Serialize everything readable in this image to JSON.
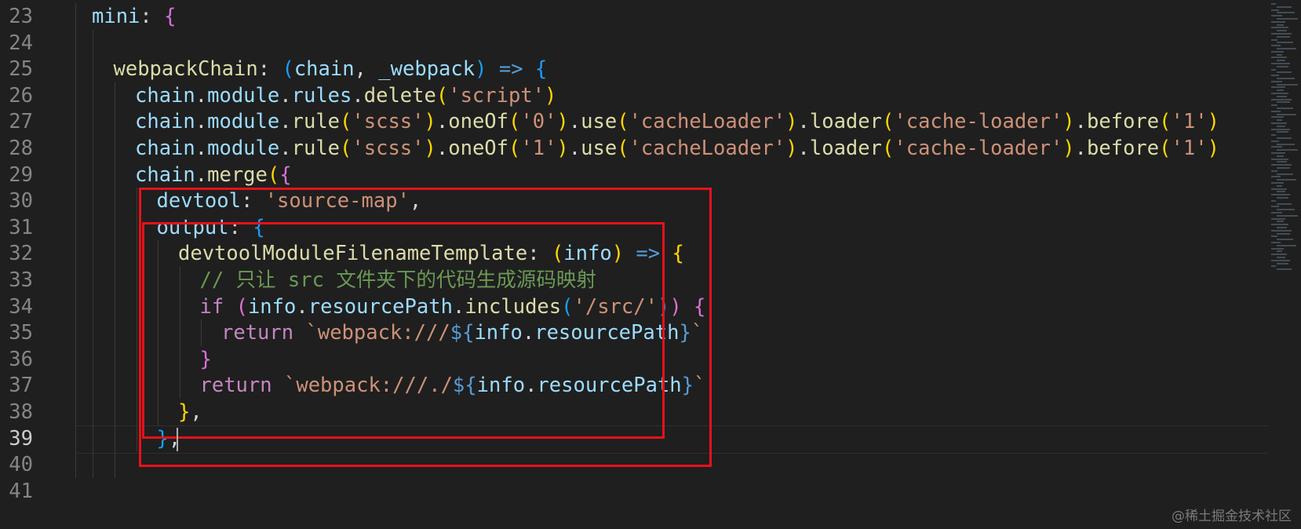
{
  "editor": {
    "colors": {
      "background": "#1f1f1f",
      "line_number": "#858585",
      "line_number_active": "#cccccc",
      "highlight_box": "#e8111b"
    },
    "token_colors": {
      "prop": "#9cdcfe",
      "punct": "#d4d4d4",
      "str": "#ce9178",
      "fn": "#dcdcaa",
      "kw": "#c586c0",
      "op": "#569cd6",
      "b1": "#ffd700",
      "b2": "#da70d6",
      "b3": "#179fff",
      "cmt": "#6a9955"
    },
    "active_line": 39,
    "lines": [
      {
        "n": "23",
        "indent": 1,
        "tokens": [
          [
            "mini",
            "prop"
          ],
          [
            ": ",
            "punct"
          ],
          [
            "{",
            "b2"
          ]
        ]
      },
      {
        "n": "24",
        "indent": 0,
        "tokens": []
      },
      {
        "n": "25",
        "indent": 2,
        "tokens": [
          [
            "webpackChain",
            "fn"
          ],
          [
            ": ",
            "punct"
          ],
          [
            "(",
            "b3"
          ],
          [
            "chain",
            "prop"
          ],
          [
            ", ",
            "punct"
          ],
          [
            "_webpack",
            "prop"
          ],
          [
            ")",
            "b3"
          ],
          [
            " => ",
            "op"
          ],
          [
            "{",
            "b3"
          ]
        ]
      },
      {
        "n": "26",
        "indent": 3,
        "tokens": [
          [
            "chain",
            "prop"
          ],
          [
            ".",
            "punct"
          ],
          [
            "module",
            "prop"
          ],
          [
            ".",
            "punct"
          ],
          [
            "rules",
            "prop"
          ],
          [
            ".",
            "punct"
          ],
          [
            "delete",
            "fn"
          ],
          [
            "(",
            "b1"
          ],
          [
            "'script'",
            "str"
          ],
          [
            ")",
            "b1"
          ]
        ]
      },
      {
        "n": "27",
        "indent": 3,
        "tokens": [
          [
            "chain",
            "prop"
          ],
          [
            ".",
            "punct"
          ],
          [
            "module",
            "prop"
          ],
          [
            ".",
            "punct"
          ],
          [
            "rule",
            "fn"
          ],
          [
            "(",
            "b1"
          ],
          [
            "'scss'",
            "str"
          ],
          [
            ")",
            "b1"
          ],
          [
            ".",
            "punct"
          ],
          [
            "oneOf",
            "fn"
          ],
          [
            "(",
            "b1"
          ],
          [
            "'0'",
            "str"
          ],
          [
            ")",
            "b1"
          ],
          [
            ".",
            "punct"
          ],
          [
            "use",
            "fn"
          ],
          [
            "(",
            "b1"
          ],
          [
            "'cacheLoader'",
            "str"
          ],
          [
            ")",
            "b1"
          ],
          [
            ".",
            "punct"
          ],
          [
            "loader",
            "fn"
          ],
          [
            "(",
            "b1"
          ],
          [
            "'cache-loader'",
            "str"
          ],
          [
            ")",
            "b1"
          ],
          [
            ".",
            "punct"
          ],
          [
            "before",
            "fn"
          ],
          [
            "(",
            "b1"
          ],
          [
            "'1'",
            "str"
          ],
          [
            ")",
            "b1"
          ]
        ]
      },
      {
        "n": "28",
        "indent": 3,
        "tokens": [
          [
            "chain",
            "prop"
          ],
          [
            ".",
            "punct"
          ],
          [
            "module",
            "prop"
          ],
          [
            ".",
            "punct"
          ],
          [
            "rule",
            "fn"
          ],
          [
            "(",
            "b1"
          ],
          [
            "'scss'",
            "str"
          ],
          [
            ")",
            "b1"
          ],
          [
            ".",
            "punct"
          ],
          [
            "oneOf",
            "fn"
          ],
          [
            "(",
            "b1"
          ],
          [
            "'1'",
            "str"
          ],
          [
            ")",
            "b1"
          ],
          [
            ".",
            "punct"
          ],
          [
            "use",
            "fn"
          ],
          [
            "(",
            "b1"
          ],
          [
            "'cacheLoader'",
            "str"
          ],
          [
            ")",
            "b1"
          ],
          [
            ".",
            "punct"
          ],
          [
            "loader",
            "fn"
          ],
          [
            "(",
            "b1"
          ],
          [
            "'cache-loader'",
            "str"
          ],
          [
            ")",
            "b1"
          ],
          [
            ".",
            "punct"
          ],
          [
            "before",
            "fn"
          ],
          [
            "(",
            "b1"
          ],
          [
            "'1'",
            "str"
          ],
          [
            ")",
            "b1"
          ]
        ]
      },
      {
        "n": "29",
        "indent": 3,
        "tokens": [
          [
            "chain",
            "prop"
          ],
          [
            ".",
            "punct"
          ],
          [
            "merge",
            "fn"
          ],
          [
            "(",
            "b1"
          ],
          [
            "{",
            "b2"
          ]
        ]
      },
      {
        "n": "30",
        "indent": 4,
        "tokens": [
          [
            "devtool",
            "prop"
          ],
          [
            ": ",
            "punct"
          ],
          [
            "'source-map'",
            "str"
          ],
          [
            ",",
            "punct"
          ]
        ]
      },
      {
        "n": "31",
        "indent": 4,
        "tokens": [
          [
            "output",
            "prop"
          ],
          [
            ": ",
            "punct"
          ],
          [
            "{",
            "b3"
          ]
        ]
      },
      {
        "n": "32",
        "indent": 5,
        "tokens": [
          [
            "devtoolModuleFilenameTemplate",
            "fn"
          ],
          [
            ": ",
            "punct"
          ],
          [
            "(",
            "b1"
          ],
          [
            "info",
            "prop"
          ],
          [
            ")",
            "b1"
          ],
          [
            " => ",
            "op"
          ],
          [
            "{",
            "b1"
          ]
        ]
      },
      {
        "n": "33",
        "indent": 6,
        "tokens": [
          [
            "// 只让 src 文件夹下的代码生成源码映射",
            "cmt"
          ]
        ]
      },
      {
        "n": "34",
        "indent": 6,
        "tokens": [
          [
            "if",
            "kw"
          ],
          [
            " ",
            "punct"
          ],
          [
            "(",
            "b2"
          ],
          [
            "info",
            "prop"
          ],
          [
            ".",
            "punct"
          ],
          [
            "resourcePath",
            "prop"
          ],
          [
            ".",
            "punct"
          ],
          [
            "includes",
            "fn"
          ],
          [
            "(",
            "b3"
          ],
          [
            "'/src/'",
            "str"
          ],
          [
            ")",
            "b3"
          ],
          [
            ")",
            "b2"
          ],
          [
            " ",
            "punct"
          ],
          [
            "{",
            "b2"
          ]
        ]
      },
      {
        "n": "35",
        "indent": 7,
        "tokens": [
          [
            "return",
            "kw"
          ],
          [
            " ",
            "punct"
          ],
          [
            "`webpack:///",
            "str"
          ],
          [
            "${",
            "op"
          ],
          [
            "info",
            "prop"
          ],
          [
            ".",
            "punct"
          ],
          [
            "resourcePath",
            "prop"
          ],
          [
            "}",
            "op"
          ],
          [
            "`",
            "str"
          ]
        ]
      },
      {
        "n": "36",
        "indent": 6,
        "tokens": [
          [
            "}",
            "b2"
          ]
        ]
      },
      {
        "n": "37",
        "indent": 6,
        "tokens": [
          [
            "return",
            "kw"
          ],
          [
            " ",
            "punct"
          ],
          [
            "`webpack:///./",
            "str"
          ],
          [
            "${",
            "op"
          ],
          [
            "info",
            "prop"
          ],
          [
            ".",
            "punct"
          ],
          [
            "resourcePath",
            "prop"
          ],
          [
            "}",
            "op"
          ],
          [
            "`",
            "str"
          ]
        ]
      },
      {
        "n": "38",
        "indent": 5,
        "tokens": [
          [
            "}",
            "b1"
          ],
          [
            ",",
            "punct"
          ]
        ]
      },
      {
        "n": "39",
        "indent": 4,
        "tokens": [
          [
            "}",
            "b3"
          ],
          [
            ",",
            "punct"
          ]
        ]
      },
      {
        "n": "40",
        "indent": 0,
        "tokens": []
      },
      {
        "n": "41",
        "indent": 0,
        "tokens": []
      }
    ]
  },
  "watermark": "@稀土掘金技术社区"
}
